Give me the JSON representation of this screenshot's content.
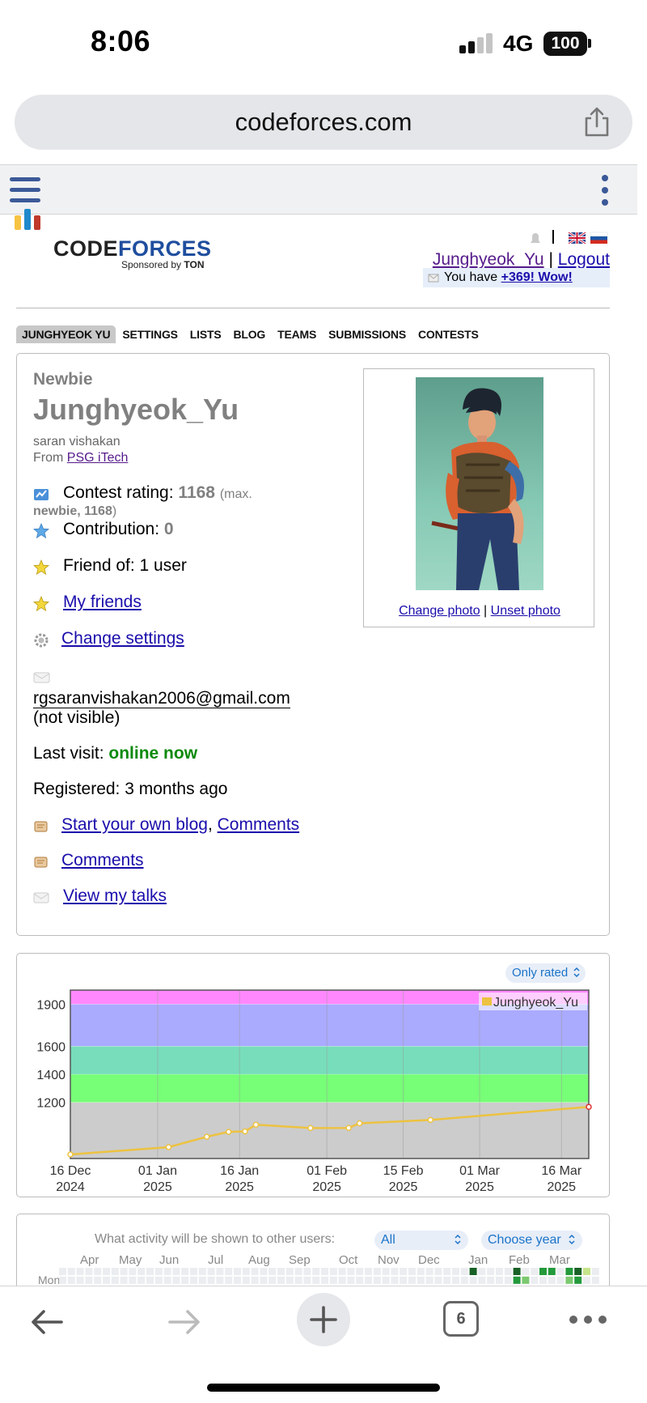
{
  "status_bar": {
    "time": "8:06",
    "network": "4G",
    "battery": "100"
  },
  "browser": {
    "url": "codeforces.com",
    "open_tabs": "6"
  },
  "header": {
    "logo_text_code": "CODE",
    "logo_text_forces": "FORCES",
    "sponsored_prefix": "Sponsored by",
    "sponsor": "TON",
    "username": "Junghyeok_Yu",
    "separator": "|",
    "logout": "Logout",
    "you_have": "You have",
    "wow": "+369! Wow!"
  },
  "nav": [
    "Junghyeok Yu",
    "Settings",
    "Lists",
    "Blog",
    "Teams",
    "Submissions",
    "Contests"
  ],
  "profile": {
    "rank": "Newbie",
    "handle": "Junghyeok_Yu",
    "real_name": "saran vishakan",
    "from_label": "From",
    "organization": "PSG iTech",
    "contest_rating_label": "Contest rating:",
    "contest_rating": "1168",
    "max_open": "(max.",
    "max_rank": "newbie, 1168",
    "max_close": ")",
    "contribution_label": "Contribution:",
    "contribution": "0",
    "friend_of": "Friend of: 1 user",
    "my_friends": "My friends",
    "change_settings": "Change settings",
    "email": "rgsaranvishakan2006@gmail.com",
    "email_visibility": "(not visible)",
    "last_visit_label": "Last visit:",
    "last_visit": "online now",
    "registered": "Registered: 3 months ago",
    "start_blog": "Start your own blog",
    "comma": ",",
    "comments": "Comments",
    "comments2": "Comments",
    "view_talks": "View my talks",
    "change_photo": "Change photo",
    "unset_photo": "Unset photo",
    "photo_sep": "|"
  },
  "rating_chart": {
    "filter": "Only rated"
  },
  "chart_data": {
    "type": "line",
    "title": "",
    "series": [
      {
        "name": "Junghyeok_Yu",
        "color": "#edc240",
        "points": [
          [
            "2024-12-16",
            829
          ],
          [
            "2025-01-03",
            881
          ],
          [
            "2025-01-10",
            955
          ],
          [
            "2025-01-14",
            990
          ],
          [
            "2025-01-17",
            993
          ],
          [
            "2025-01-19",
            1041
          ],
          [
            "2025-01-29",
            1017
          ],
          [
            "2025-02-05",
            1018
          ],
          [
            "2025-02-07",
            1051
          ],
          [
            "2025-02-20",
            1075
          ],
          [
            "2025-03-21",
            1168
          ]
        ]
      }
    ],
    "x_ticks": [
      [
        "16 Dec",
        "2024"
      ],
      [
        "01 Jan",
        "2025"
      ],
      [
        "16 Jan",
        "2025"
      ],
      [
        "01 Feb",
        "2025"
      ],
      [
        "15 Feb",
        "2025"
      ],
      [
        "01 Mar",
        "2025"
      ],
      [
        "16 Mar",
        "2025"
      ]
    ],
    "y_ticks": [
      "1200",
      "1400",
      "1600",
      "1900"
    ],
    "x_range": [
      "2024-12-16",
      "2025-03-21"
    ],
    "y_range": [
      800,
      2000
    ],
    "bands": [
      {
        "from": 800,
        "to": 1200,
        "color": "#cccccc"
      },
      {
        "from": 1200,
        "to": 1400,
        "color": "#77ff77"
      },
      {
        "from": 1400,
        "to": 1600,
        "color": "#77ddbb"
      },
      {
        "from": 1600,
        "to": 1900,
        "color": "#aaaaff"
      },
      {
        "from": 1900,
        "to": 2000,
        "color": "#ff88ff"
      }
    ],
    "grid": true,
    "legend": "top-right"
  },
  "activity": {
    "label": "What activity will be shown to other users:",
    "visibility": "All",
    "year": "Choose year",
    "months": [
      "Apr",
      "May",
      "Jun",
      "Jul",
      "Aug",
      "Sep",
      "Oct",
      "Nov",
      "Dec",
      "Jan",
      "Feb",
      "Mar"
    ],
    "day_label": "Mon"
  }
}
